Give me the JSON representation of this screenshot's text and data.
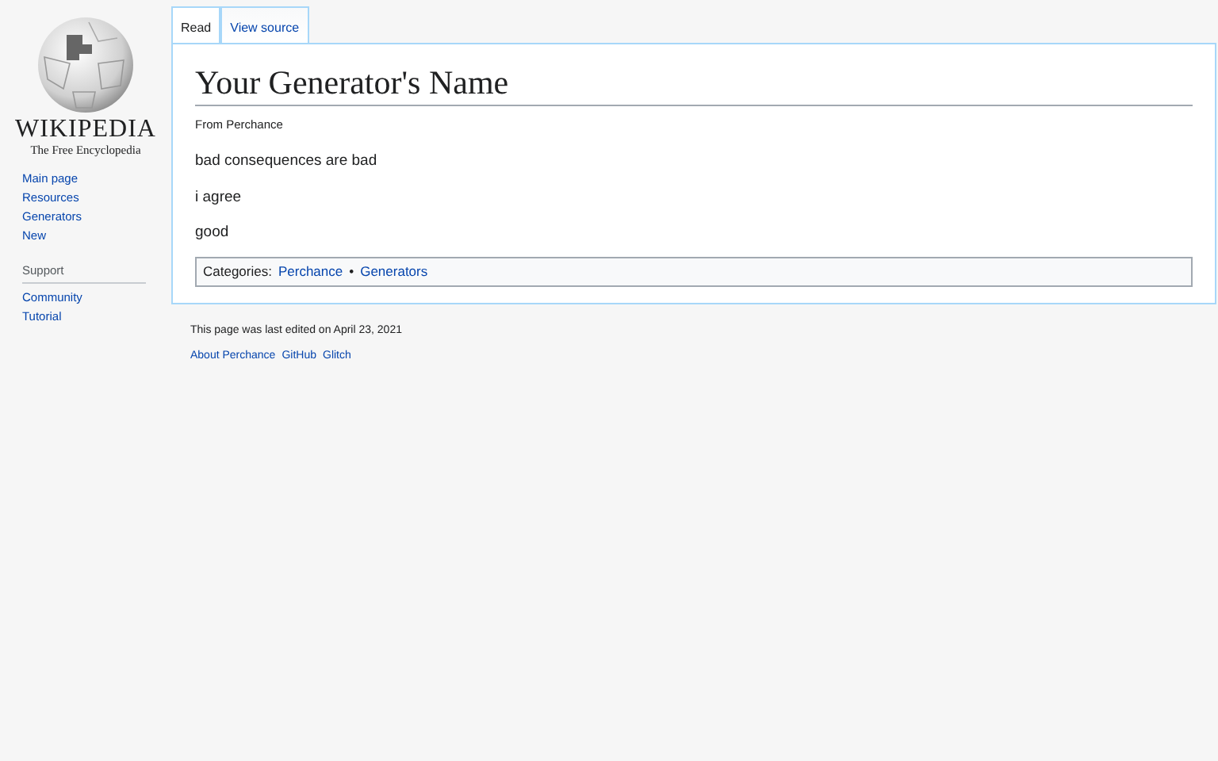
{
  "logo": {
    "wordmark": "WIKIPEDIA",
    "tagline": "The Free Encyclopedia"
  },
  "nav": [
    "Main page",
    "Resources",
    "Generators",
    "New"
  ],
  "support": {
    "heading": "Support",
    "items": [
      "Community",
      "Tutorial"
    ]
  },
  "tabs": [
    {
      "label": "Read",
      "selected": true
    },
    {
      "label": "View source",
      "selected": false
    }
  ],
  "article": {
    "title": "Your Generator's Name",
    "subtitle": "From Perchance",
    "paragraphs": [
      "bad consequences are bad",
      "i agree",
      "good"
    ],
    "categories": {
      "label": "Categories:",
      "separator": "•",
      "items": [
        "Perchance",
        "Generators"
      ]
    }
  },
  "footer": {
    "last_edited": "This page was last edited on April 23, 2021",
    "links": [
      "About Perchance",
      "GitHub",
      "Glitch"
    ]
  }
}
